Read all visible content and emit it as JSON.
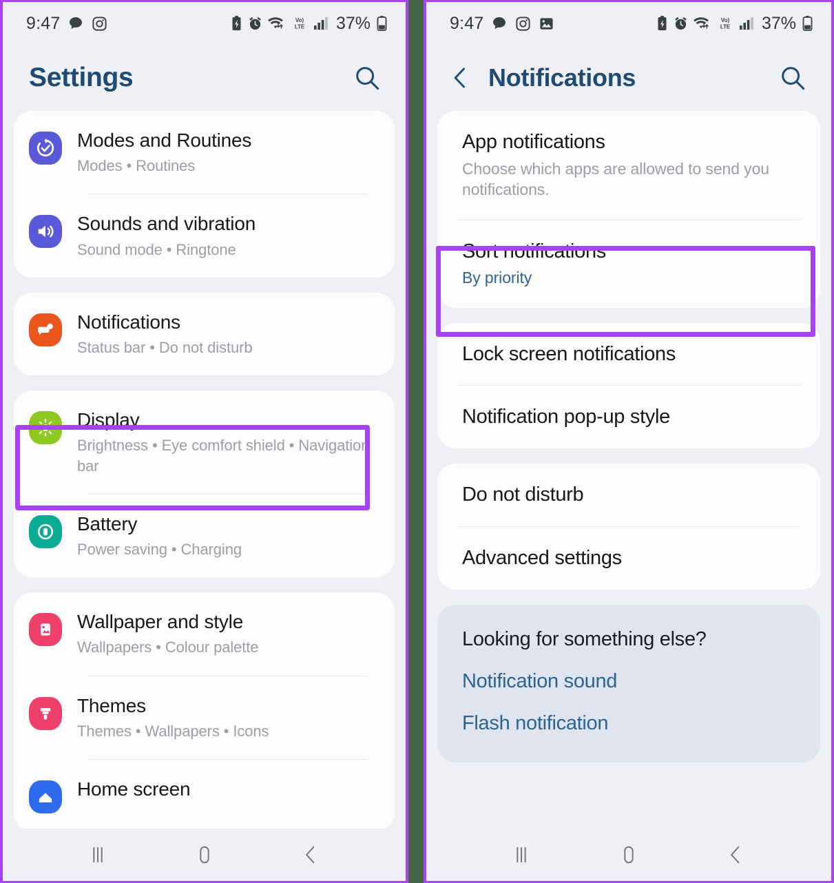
{
  "meta": {
    "accent_highlight": "#a742f5",
    "divider_color": "#456647",
    "title_color": "#1e4a73",
    "page_bg": "#eff0f5"
  },
  "status_bar": {
    "time": "9:47",
    "battery_percent": "37%",
    "network_label": "LTE",
    "volte_label": "Vo)",
    "left_icons": [
      "speech-bubble-icon",
      "instagram-icon",
      "image-icon"
    ],
    "right_icons": [
      "battery-saver-icon",
      "alarm-icon",
      "wifi-icon",
      "volte-icon",
      "signal-icon",
      "battery-icon"
    ]
  },
  "left_screen": {
    "header": {
      "title": "Settings",
      "search_icon": "search-icon"
    },
    "groups": [
      {
        "items": [
          {
            "title": "Modes and Routines",
            "subtitle": "Modes  •  Routines",
            "icon": "modes-routines-icon",
            "icon_color": "#5a5ad8",
            "highlighted": false
          },
          {
            "title": "Sounds and vibration",
            "subtitle": "Sound mode  •  Ringtone",
            "icon": "sound-volume-icon",
            "icon_color": "#5a5ad8",
            "highlighted": false
          }
        ]
      },
      {
        "items": [
          {
            "title": "Notifications",
            "subtitle": "Status bar  •  Do not disturb",
            "icon": "notifications-bubble-icon",
            "icon_color": "#e8551d",
            "highlighted": true
          }
        ]
      },
      {
        "items": [
          {
            "title": "Display",
            "subtitle": "Brightness  •  Eye comfort shield  •  Navigation bar",
            "icon": "brightness-sun-icon",
            "icon_color": "#8dc91e",
            "highlighted": false
          },
          {
            "title": "Battery",
            "subtitle": "Power saving  •  Charging",
            "icon": "battery-circle-icon",
            "icon_color": "#0bab96",
            "highlighted": false
          }
        ]
      },
      {
        "items": [
          {
            "title": "Wallpaper and style",
            "subtitle": "Wallpapers  •  Colour palette",
            "icon": "wallpaper-image-icon",
            "icon_color": "#ef4069",
            "highlighted": false
          },
          {
            "title": "Themes",
            "subtitle": "Themes  •  Wallpapers  •  Icons",
            "icon": "themes-brush-icon",
            "icon_color": "#ee4069",
            "highlighted": false
          },
          {
            "title": "Home screen",
            "subtitle": "",
            "icon": "home-screen-icon",
            "icon_color": "#2f6bf0",
            "highlighted": false
          }
        ]
      }
    ]
  },
  "right_screen": {
    "header": {
      "back_icon": "chevron-left-icon",
      "title": "Notifications",
      "search_icon": "search-icon"
    },
    "groups": [
      {
        "items": [
          {
            "title": "App notifications",
            "subtitle": "Choose which apps are allowed to send you notifications.",
            "subtitle_link": false,
            "highlighted": true
          },
          {
            "title": "Sort notifications",
            "subtitle": "By priority",
            "subtitle_link": true,
            "highlighted": false
          }
        ]
      },
      {
        "items": [
          {
            "title": "Lock screen notifications",
            "subtitle": "",
            "subtitle_link": false,
            "highlighted": false
          },
          {
            "title": "Notification pop-up style",
            "subtitle": "",
            "subtitle_link": false,
            "highlighted": false
          }
        ]
      },
      {
        "items": [
          {
            "title": "Do not disturb",
            "subtitle": "",
            "subtitle_link": false,
            "highlighted": false
          },
          {
            "title": "Advanced settings",
            "subtitle": "",
            "subtitle_link": false,
            "highlighted": false
          }
        ]
      }
    ],
    "hint": {
      "title": "Looking for something else?",
      "links": [
        "Notification sound",
        "Flash notification"
      ]
    }
  },
  "nav_bar": {
    "recents_label": "recents-icon",
    "home_label": "home-icon",
    "back_label": "back-icon"
  }
}
